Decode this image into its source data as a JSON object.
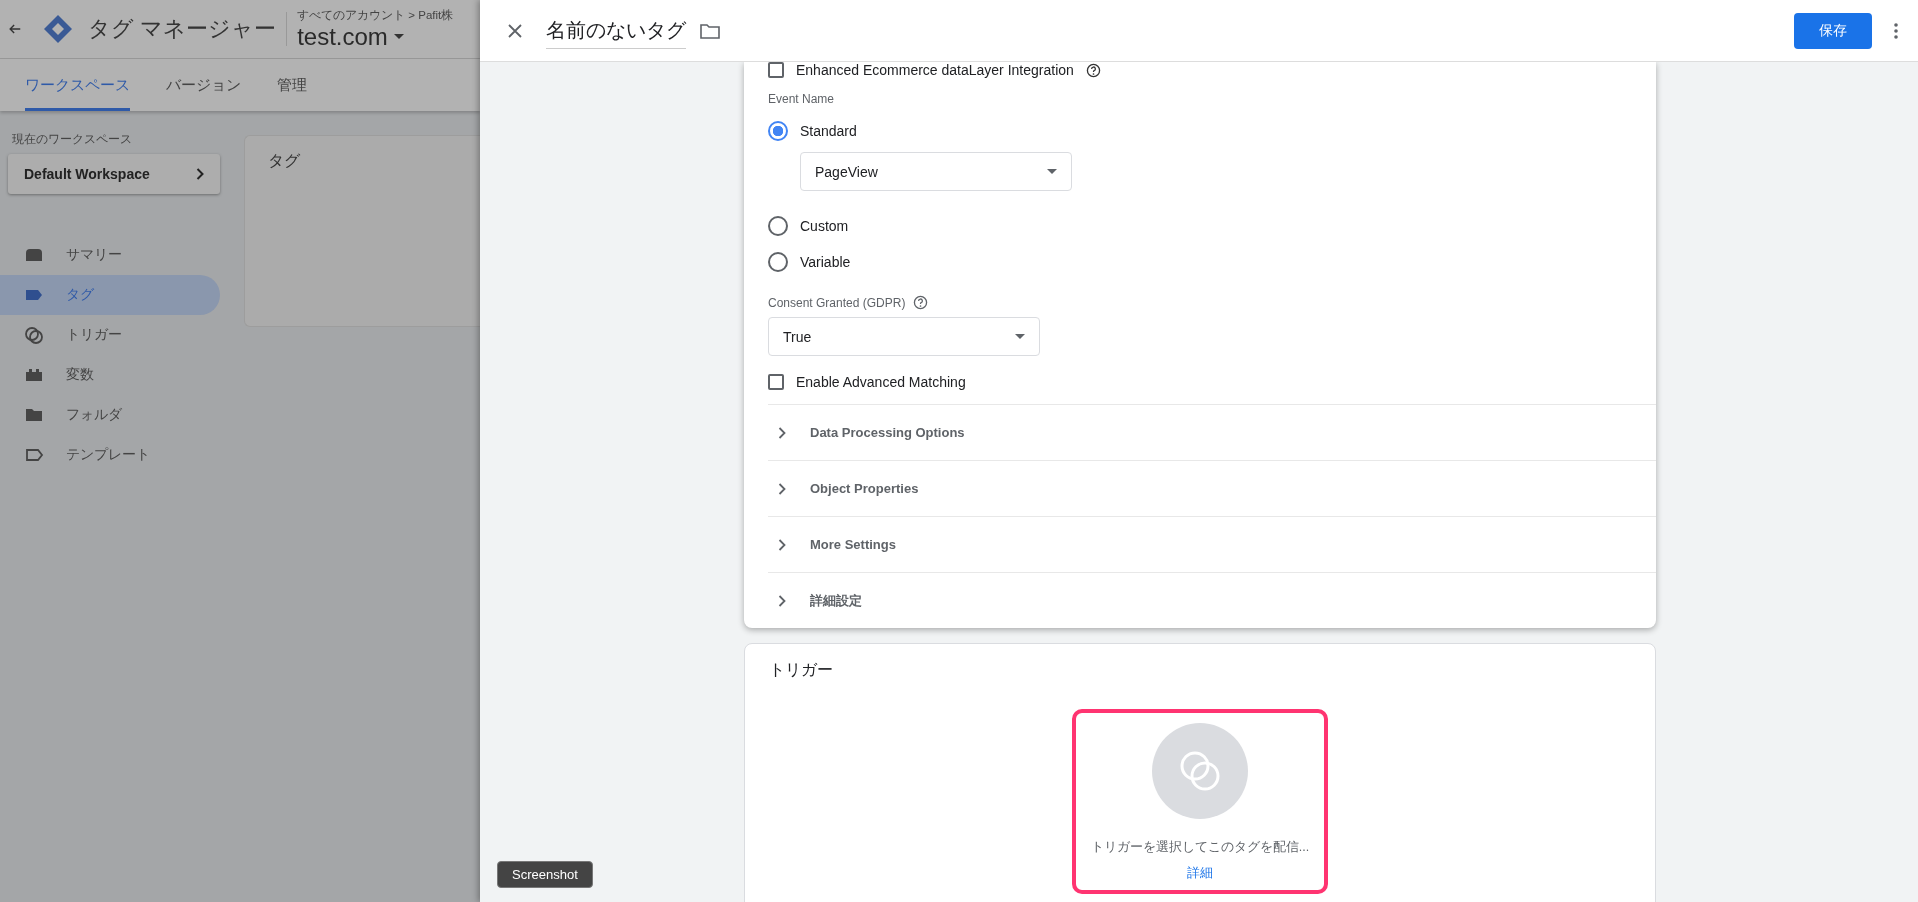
{
  "app_header": {
    "product": "タグ マネージャー",
    "breadcrumb": "すべてのアカウント > Pafit株",
    "container": "test.com"
  },
  "tabs": [
    {
      "label": "ワークスペース",
      "selected": true
    },
    {
      "label": "バージョン",
      "selected": false
    },
    {
      "label": "管理",
      "selected": false
    }
  ],
  "workspace": {
    "label": "現在のワークスペース",
    "name": "Default Workspace"
  },
  "sidebar": {
    "items": [
      {
        "label": "サマリー",
        "kind": "summary",
        "selected": false
      },
      {
        "label": "タグ",
        "kind": "tag",
        "selected": true
      },
      {
        "label": "トリガー",
        "kind": "trigger",
        "selected": false
      },
      {
        "label": "変数",
        "kind": "variable",
        "selected": false
      },
      {
        "label": "フォルダ",
        "kind": "folder",
        "selected": false
      },
      {
        "label": "テンプレート",
        "kind": "template",
        "selected": false
      }
    ]
  },
  "tags_card": {
    "title": "タグ"
  },
  "panel": {
    "title": "名前のないタグ",
    "save": "保存"
  },
  "config": {
    "enhanced": {
      "label": "Enhanced Ecommerce dataLayer Integration",
      "checked": false
    },
    "event_name": {
      "label": "Event Name",
      "options": [
        {
          "label": "Standard",
          "selected": true
        },
        {
          "label": "Custom",
          "selected": false
        },
        {
          "label": "Variable",
          "selected": false
        }
      ],
      "select": "PageView"
    },
    "consent": {
      "label": "Consent Granted (GDPR)",
      "value": "True"
    },
    "advanced_matching": {
      "label": "Enable Advanced Matching",
      "checked": false
    },
    "sections": [
      {
        "label": "Data Processing Options",
        "expanded": false
      },
      {
        "label": "Object Properties",
        "expanded": false
      },
      {
        "label": "More Settings",
        "expanded": false
      },
      {
        "label": "詳細設定",
        "expanded": false
      }
    ]
  },
  "trigger": {
    "title": "トリガー",
    "hint": "トリガーを選択してこのタグを配信...",
    "link": "詳細",
    "highlighted": true
  },
  "tooltip": "Screenshot"
}
